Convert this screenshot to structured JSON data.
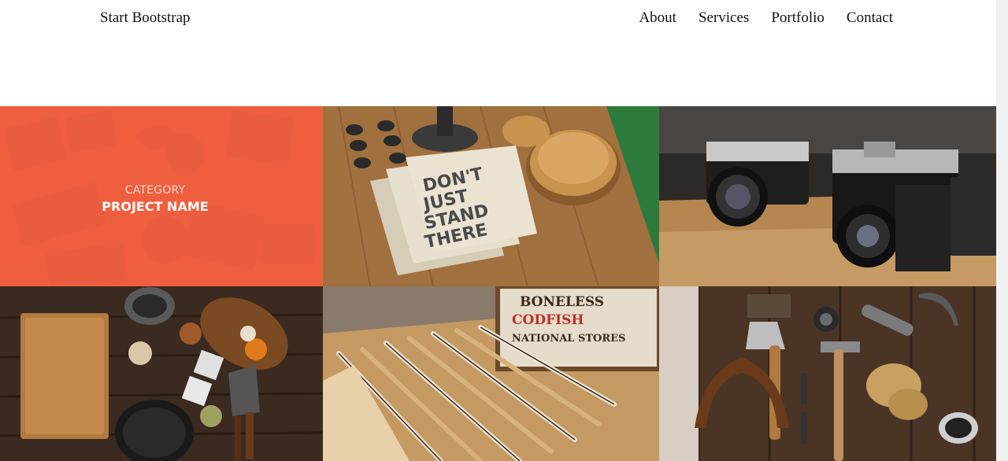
{
  "navbar": {
    "brand": "Start Bootstrap",
    "links": [
      "About",
      "Services",
      "Portfolio",
      "Contact"
    ]
  },
  "portfolio": {
    "items": [
      {
        "category": "Category",
        "name": "Project Name",
        "image": "stamps-letterpress-overlay"
      },
      {
        "image": "dont-just-stand-there-notebooks"
      },
      {
        "image": "vintage-cameras"
      },
      {
        "image": "cutting-board-kitchen"
      },
      {
        "image": "rulers-codfish-box"
      },
      {
        "image": "hammer-tools"
      }
    ]
  },
  "colors": {
    "overlay_accent": "#f05f40"
  }
}
